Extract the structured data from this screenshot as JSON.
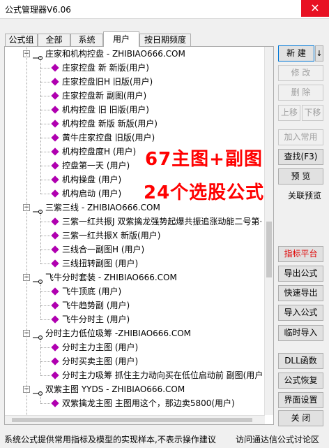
{
  "window": {
    "title": "公式管理器V6.06",
    "close_glyph": "✕"
  },
  "tabs": [
    {
      "label": "公式组"
    },
    {
      "label": "全部"
    },
    {
      "label": "系统"
    },
    {
      "label": "用户"
    },
    {
      "label": "按日期频度"
    }
  ],
  "tree": {
    "groups": [
      {
        "label": "庄家和机构控盘 - ZHIBIAO666.COM",
        "children": [
          "庄家控盘 新  新版(用户)",
          "庄家控盘旧H  旧版(用户)",
          "庄家控盘新  副图(用户)",
          "机构控盘 旧  旧版(用户)",
          "机构控盘 新版  新版(用户)",
          "黄牛庄家控盘  旧版(用户)",
          "机构控盘度H  (用户)",
          "控盘第一天  (用户)",
          "机构操盘  (用户)",
          "机构启动  (用户)"
        ]
      },
      {
        "label": "三紫三线 - ZHIBIAO666.COM",
        "children": [
          "三紫一红共振J  双紫擒龙强势起爆共振追涨动能二号第·",
          "三紫一红共振X 新版(用户)",
          "三线合一副图H  (用户)",
          "三线扭转副图  (用户)"
        ]
      },
      {
        "label": "飞牛分时套装 - ZHIBIAO666.COM",
        "children": [
          "飞牛顶底 (用户)",
          "飞牛趋势副 (用户)",
          "飞牛分时主 (用户)"
        ]
      },
      {
        "label": "分时主力低位吸筹 -ZHIBIAO666.COM",
        "children": [
          "分时主力主图  (用户)",
          "分时买卖主图  (用户)",
          "分时主力吸筹  抓住主力动向买在低位启动前 副图(用户"
        ]
      },
      {
        "label": "双紫主图 YYDS - ZHIBIAO666.COM",
        "children": [
          "双紫擒龙主图 主图用这个，那边卖5800(用户)"
        ]
      }
    ]
  },
  "buttons": {
    "new": "新  建",
    "new_arrow": "↓",
    "modify": "修  改",
    "delete": "删  除",
    "move_up": "上移",
    "move_down": "下移",
    "add_common": "加入常用",
    "find": "查找(F3)",
    "preview": "预  览",
    "linked_preview": "关联预览",
    "indicator_platform": "指标平台",
    "export": "导出公式",
    "quick_export": "快速导出",
    "import": "导入公式",
    "temp_import": "临时导入",
    "dll": "DLL函数",
    "restore": "公式恢复",
    "ui_settings": "界面设置",
    "close": "关  闭"
  },
  "overlay": {
    "line1": "67主图+副图",
    "line2": "24个选股公式"
  },
  "status": {
    "left": "系统公式提供常用指标及模型的实现样本,不表示操作建议",
    "right": "访问通达信公式讨论区"
  },
  "colors": {
    "overlay": "#ff0000",
    "leaf_icon": "#b000b0",
    "close": "#e81123",
    "accent": "#0078d7"
  }
}
